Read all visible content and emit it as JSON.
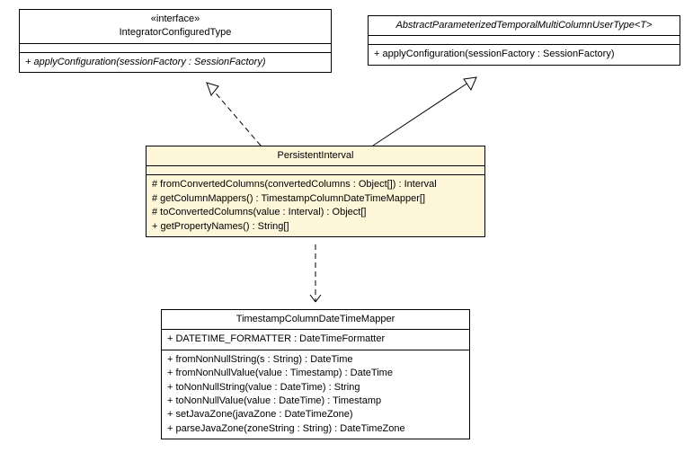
{
  "interface_box": {
    "stereotype": "«interface»",
    "name": "IntegratorConfiguredType",
    "methods": [
      "+ applyConfiguration(sessionFactory : SessionFactory)"
    ]
  },
  "abstract_box": {
    "name": "AbstractParameterizedTemporalMultiColumnUserType<T>",
    "methods": [
      "+ applyConfiguration(sessionFactory : SessionFactory)"
    ]
  },
  "persistent_box": {
    "name": "PersistentInterval",
    "methods": [
      "# fromConvertedColumns(convertedColumns : Object[]) : Interval",
      "# getColumnMappers() : TimestampColumnDateTimeMapper[]",
      "# toConvertedColumns(value : Interval) : Object[]",
      "+ getPropertyNames() : String[]"
    ]
  },
  "mapper_box": {
    "name": "TimestampColumnDateTimeMapper",
    "fields": [
      "+ DATETIME_FORMATTER : DateTimeFormatter"
    ],
    "methods": [
      "+ fromNonNullString(s : String) : DateTime",
      "+ fromNonNullValue(value : Timestamp) : DateTime",
      "+ toNonNullString(value : DateTime) : String",
      "+ toNonNullValue(value : DateTime) : Timestamp",
      "+ setJavaZone(javaZone : DateTimeZone)",
      "+ parseJavaZone(zoneString : String) : DateTimeZone"
    ]
  }
}
